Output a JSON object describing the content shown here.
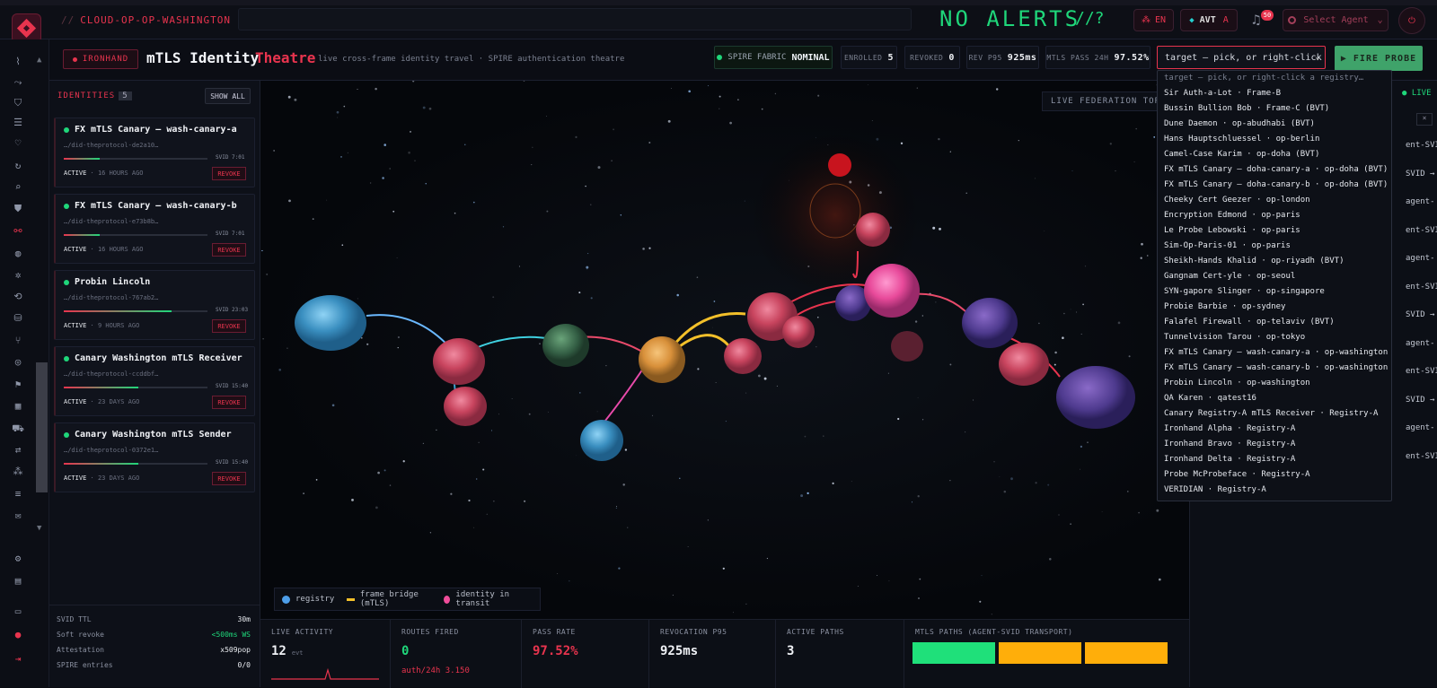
{
  "app": {
    "brand": "CLOUD-OP-OP-WASHINGTON",
    "brand_prefix": "//",
    "alerts": "NO ALERTS",
    "alerts_icon": "//?",
    "lang": "EN",
    "avt": "AVT",
    "avt_suffix": "A",
    "notif_count": "50",
    "agent_select": "Select Agent"
  },
  "header": {
    "tag": "IRONHAND",
    "title": "mTLS Identity",
    "title_accent": "Theatre",
    "subtitle": "live cross-frame identity travel · SPIRE authentication theatre",
    "spire_label": "SPIRE FABRIC",
    "spire_status": "NOMINAL",
    "stats": [
      {
        "label": "ENROLLED",
        "value": "5"
      },
      {
        "label": "REVOKED",
        "value": "0"
      },
      {
        "label": "REV P95",
        "value": "925ms"
      },
      {
        "label": "MTLS PASS 24H",
        "value": "97.52%"
      }
    ],
    "target_value": "target — pick, or right-click a r",
    "fire_label": "▶ FIRE PROBE"
  },
  "sidebar": {
    "heading": "IDENTITIES",
    "count": "5",
    "show_all": "SHOW ALL",
    "identities": [
      {
        "name": "FX mTLS Canary — wash-canary-a",
        "did": "…/did-theprotocol-de2a10…",
        "svid": "SVID 7:01",
        "status": "ACTIVE",
        "age": "· 16 HOURS AGO",
        "revoke": "REVOKE",
        "progress": 0.25
      },
      {
        "name": "FX mTLS Canary — wash-canary-b",
        "did": "…/did-theprotocol-e73b8b…",
        "svid": "SVID 7:01",
        "status": "ACTIVE",
        "age": "· 16 HOURS AGO",
        "revoke": "REVOKE",
        "progress": 0.25
      },
      {
        "name": "Probin Lincoln",
        "did": "…/did-theprotocol-767ab2…",
        "svid": "SVID 23:03",
        "status": "ACTIVE",
        "age": "· 9 HOURS AGO",
        "revoke": "REVOKE",
        "progress": 0.75
      },
      {
        "name": "Canary Washington mTLS Receiver",
        "did": "…/did-theprotocol-ccddbf…",
        "svid": "SVID 15:40",
        "status": "ACTIVE",
        "age": "· 23 DAYS AGO",
        "revoke": "REVOKE",
        "progress": 0.52
      },
      {
        "name": "Canary Washington mTLS Sender",
        "did": "…/did-theprotocol-0372e1…",
        "svid": "SVID 15:40",
        "status": "ACTIVE",
        "age": "· 23 DAYS AGO",
        "revoke": "REVOKE",
        "progress": 0.52
      }
    ],
    "footer": [
      {
        "label": "SVID TTL",
        "value": "30m"
      },
      {
        "label": "Soft revoke",
        "value": "<500ms WS"
      },
      {
        "label": "Attestation",
        "value": "x509pop"
      },
      {
        "label": "SPIRE entries",
        "value": "0/0"
      }
    ]
  },
  "canvas": {
    "federation_label": "LIVE FEDERATION TOPOL",
    "legend": [
      {
        "label": "registry",
        "color": "#4d9ee8"
      },
      {
        "label": "frame bridge (mTLS)",
        "color": "#f3c02a"
      },
      {
        "label": "identity in transit",
        "color": "#f04d9a"
      }
    ]
  },
  "right_panel": {
    "live": "LIVE",
    "close": "×",
    "items": [
      "ent-SVID",
      "SVID →",
      "agent-",
      "ent-SVID",
      "agent-",
      "ent-SVID",
      "SVID →",
      "agent-",
      "ent-SVID",
      "SVID →",
      "agent-",
      "ent-SVID"
    ]
  },
  "dropdown": {
    "placeholder": "target — pick, or right-click a registry…",
    "options": [
      "Sir Auth-a-Lot · Frame-B",
      "Bussin Bullion Bob · Frame-C (BVT)",
      "Dune Daemon · op-abudhabi (BVT)",
      "Hans Hauptschluessel · op-berlin",
      "Camel-Case Karim · op-doha (BVT)",
      "FX mTLS Canary — doha-canary-a · op-doha (BVT)",
      "FX mTLS Canary — doha-canary-b · op-doha (BVT)",
      "Cheeky Cert Geezer · op-london",
      "Encryption Edmond · op-paris",
      "Le Probe Lebowski · op-paris",
      "Sim-Op-Paris-01 · op-paris",
      "Sheikh-Hands Khalid · op-riyadh (BVT)",
      "Gangnam Cert-yle · op-seoul",
      "SYN-gapore Slinger · op-singapore",
      "Probie Barbie · op-sydney",
      "Falafel Firewall · op-telaviv (BVT)",
      "Tunnelvision Tarou · op-tokyo",
      "FX mTLS Canary — wash-canary-a · op-washington",
      "FX mTLS Canary — wash-canary-b · op-washington",
      "Probin Lincoln · op-washington",
      "QA Karen · qatest16",
      "Canary Registry-A mTLS Receiver · Registry-A",
      "Ironhand Alpha · Registry-A",
      "Ironhand Bravo · Registry-A",
      "Ironhand Delta · Registry-A",
      "Probe McProbeface · Registry-A",
      "VERIDIAN · Registry-A"
    ]
  },
  "bottom": {
    "live_activity_label": "LIVE ACTIVITY",
    "live_activity_value": "12",
    "live_activity_unit": "evt",
    "routes_label": "ROUTES FIRED",
    "routes_value": "0",
    "routes_sub": "auth/24h 3.150",
    "pass_label": "PASS RATE",
    "pass_value": "97.52%",
    "rev_label": "REVOCATION P95",
    "rev_value": "925ms",
    "paths_label": "ACTIVE PATHS",
    "paths_value": "3",
    "mtls_label": "MTLS PATHS (AGENT-SVID TRANSPORT)",
    "mtls_colors": [
      "#1fe07a",
      "#ffae0a",
      "#ffae0a"
    ]
  }
}
